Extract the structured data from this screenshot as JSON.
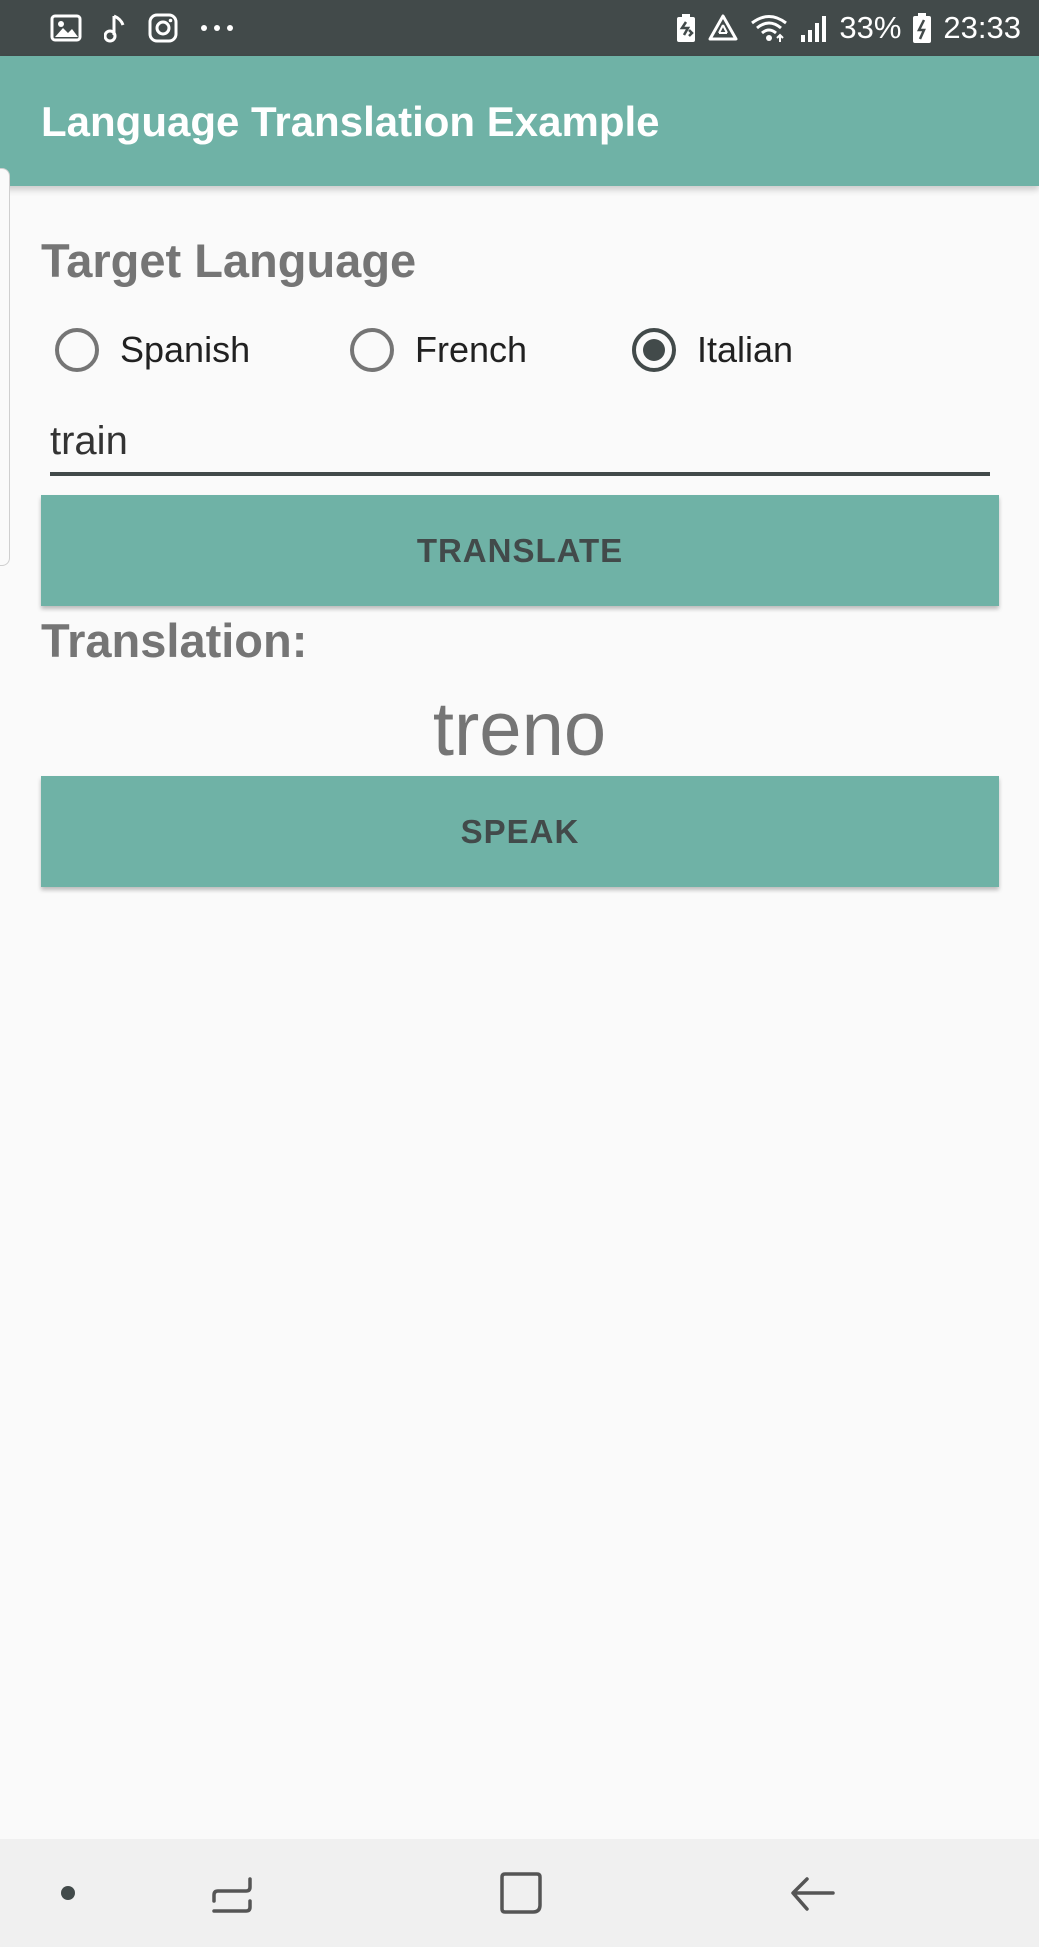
{
  "status_bar": {
    "battery_percent": "33%",
    "time": "23:33",
    "left_icons": [
      "gallery-icon",
      "music-note-icon",
      "instagram-icon",
      "more-dots-icon"
    ],
    "right_icons": [
      "battery-saver-icon",
      "recycle-icon",
      "wifi-icon",
      "signal-icon",
      "battery-icon"
    ]
  },
  "app_bar": {
    "title": "Language Translation Example"
  },
  "target_language": {
    "heading": "Target Language",
    "options": [
      {
        "label": "Spanish",
        "checked": false
      },
      {
        "label": "French",
        "checked": false
      },
      {
        "label": "Italian",
        "checked": true
      }
    ]
  },
  "input": {
    "value": "train"
  },
  "buttons": {
    "translate_label": "TRANSLATE",
    "speak_label": "SPEAK"
  },
  "translation": {
    "heading": "Translation:",
    "result": "treno"
  },
  "nav_bar": {
    "items": [
      "dot-icon",
      "recents-icon",
      "home-icon",
      "back-icon"
    ]
  },
  "colors": {
    "primary": "#6fb2a6",
    "status_bar": "#424a4a",
    "heading_text": "#757575",
    "background": "#fafafa"
  }
}
